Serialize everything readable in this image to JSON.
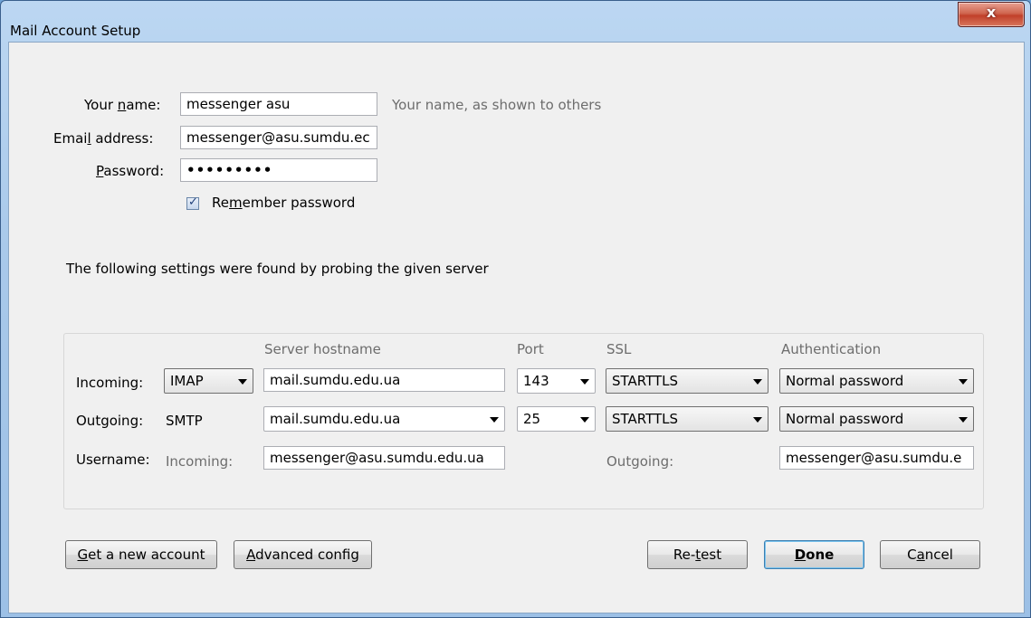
{
  "window": {
    "title": "Mail Account Setup",
    "close_glyph": "x"
  },
  "form": {
    "name_label_pre": "Your ",
    "name_label_key": "n",
    "name_label_post": "ame:",
    "name_value": "messenger asu",
    "name_hint": "Your name, as shown to others",
    "email_label_pre": "Emai",
    "email_label_key": "l",
    "email_label_post": " address:",
    "email_value": "messenger@asu.sumdu.ec",
    "password_label_key": "P",
    "password_label_post": "assword:",
    "password_value": "•••••••••",
    "remember_checked": true,
    "remember_pre": "Re",
    "remember_key": "m",
    "remember_post": "ember password"
  },
  "probe_message": "The following settings were found by probing the given server",
  "server": {
    "headers": {
      "hostname": "Server hostname",
      "port": "Port",
      "ssl": "SSL",
      "auth": "Authentication"
    },
    "incoming": {
      "label": "Incoming:",
      "protocol": "IMAP",
      "hostname": "mail.sumdu.edu.ua",
      "port": "143",
      "ssl": "STARTTLS",
      "auth": "Normal password"
    },
    "outgoing": {
      "label": "Outgoing:",
      "protocol": "SMTP",
      "hostname": "mail.sumdu.edu.ua",
      "port": "25",
      "ssl": "STARTTLS",
      "auth": "Normal password"
    },
    "username": {
      "label": "Username:",
      "incoming_label": "Incoming:",
      "incoming_value": "messenger@asu.sumdu.edu.ua",
      "outgoing_label": "Outgoing:",
      "outgoing_value": "messenger@asu.sumdu.e"
    }
  },
  "buttons": {
    "new_account_key": "G",
    "new_account_post": "et a new account",
    "advanced_key": "A",
    "advanced_post": "dvanced config",
    "retest_pre": "Re-",
    "retest_key": "t",
    "retest_post": "est",
    "done_key": "D",
    "done_post": "one",
    "cancel_pre": "C",
    "cancel_key": "a",
    "cancel_post": "ncel"
  }
}
